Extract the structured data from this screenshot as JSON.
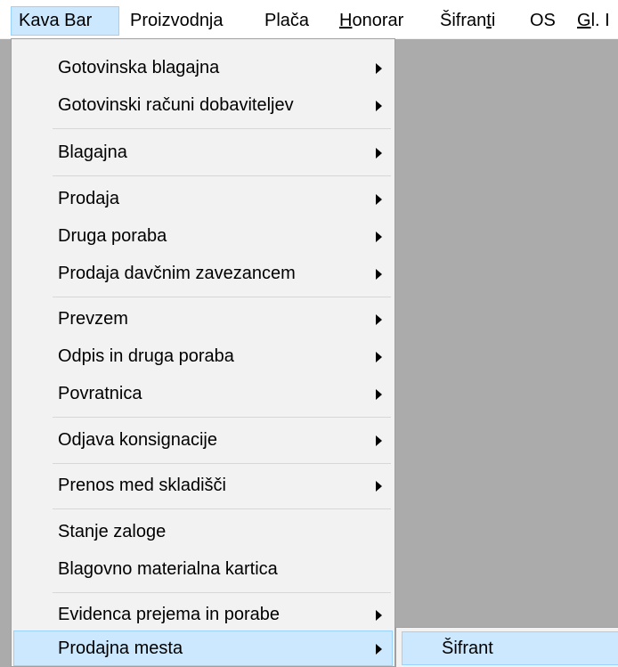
{
  "menubar": {
    "items": [
      {
        "label": "Kava Bar"
      },
      {
        "label": "Proizvodnja"
      },
      {
        "label": "Plača"
      },
      {
        "label": "Honorar",
        "mnemonic_prefix": "",
        "mnemonic": "H",
        "rest": "onorar"
      },
      {
        "label": "Šifranti",
        "pre": "Šifran",
        "mnemonic": "t",
        "rest": "i"
      },
      {
        "label": "OS"
      },
      {
        "label": "Gl. I",
        "mnemonic": "G",
        "rest": "l. I"
      }
    ]
  },
  "menu": {
    "items": [
      {
        "label": "Gotovinska blagajna",
        "submenu": true
      },
      {
        "label": "Gotovinski računi dobaviteljev",
        "submenu": true
      },
      {
        "label": "Blagajna",
        "submenu": true
      },
      {
        "label": "Prodaja",
        "submenu": true
      },
      {
        "label": "Druga poraba",
        "submenu": true
      },
      {
        "label": "Prodaja davčnim zavezancem",
        "submenu": true
      },
      {
        "label": "Prevzem",
        "submenu": true
      },
      {
        "label": "Odpis in druga poraba",
        "submenu": true
      },
      {
        "label": "Povratnica",
        "submenu": true
      },
      {
        "label": "Odjava konsignacije",
        "submenu": true
      },
      {
        "label": "Prenos med skladišči",
        "submenu": true
      },
      {
        "label": "Stanje zaloge",
        "submenu": false
      },
      {
        "label": "Blagovno materialna kartica",
        "submenu": false
      },
      {
        "label": "Evidenca prejema in porabe",
        "submenu": true
      },
      {
        "label": "Prodajna mesta",
        "submenu": true,
        "highlighted": true
      }
    ]
  },
  "submenu": {
    "items": [
      {
        "label": "Šifrant",
        "highlighted": true
      }
    ]
  },
  "colors": {
    "highlight": "#cce8ff",
    "highlight_border": "#99d1ff",
    "menu_bg": "#f2f2f2",
    "workspace": "#ababab"
  }
}
